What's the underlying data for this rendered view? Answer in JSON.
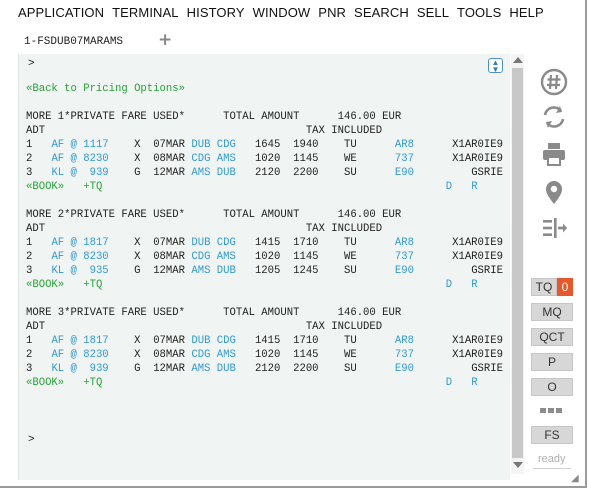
{
  "menu": [
    "APPLICATION",
    "TERMINAL",
    "HISTORY",
    "WINDOW",
    "PNR",
    "SEARCH",
    "SELL",
    "TOOLS",
    "HELP"
  ],
  "tab": {
    "label": "1-FSDUB07MARAMS",
    "add_symbol": "+"
  },
  "terminal": {
    "prompt": ">",
    "back_link": "«Back to Pricing Options»",
    "blocks": [
      {
        "header_left": "MORE 1*PRIVATE FARE USED*",
        "total_label": "TOTAL AMOUNT",
        "total_value": "146.00 EUR",
        "pax": "ADT",
        "tax_label": "TAX INCLUDED",
        "segments": [
          {
            "n": "1",
            "airline": "AF",
            "at": "@",
            "flight": "1117",
            "cls": "X",
            "date": "07MAR",
            "from": "DUB",
            "to": "CDG",
            "dep": "1645",
            "arr": "1940",
            "day": "TU",
            "equip": "AR8",
            "fare": "X1AR0IE9"
          },
          {
            "n": "2",
            "airline": "AF",
            "at": "@",
            "flight": "8230",
            "cls": "X",
            "date": "08MAR",
            "from": "CDG",
            "to": "AMS",
            "dep": "1020",
            "arr": "1145",
            "day": "WE",
            "equip": "737",
            "fare": "X1AR0IE9"
          },
          {
            "n": "3",
            "airline": "KL",
            "at": "@",
            "flight": "939",
            "cls": "G",
            "date": "12MAR",
            "from": "AMS",
            "to": "DUB",
            "dep": "2120",
            "arr": "2200",
            "day": "SU",
            "equip": "E90",
            "fare": "GSRIE"
          }
        ],
        "book": "«BOOK»",
        "tq": "+TQ",
        "d": "D",
        "r": "R"
      },
      {
        "header_left": "MORE 2*PRIVATE FARE USED*",
        "total_label": "TOTAL AMOUNT",
        "total_value": "146.00 EUR",
        "pax": "ADT",
        "tax_label": "TAX INCLUDED",
        "segments": [
          {
            "n": "1",
            "airline": "AF",
            "at": "@",
            "flight": "1817",
            "cls": "X",
            "date": "07MAR",
            "from": "DUB",
            "to": "CDG",
            "dep": "1415",
            "arr": "1710",
            "day": "TU",
            "equip": "AR8",
            "fare": "X1AR0IE9"
          },
          {
            "n": "2",
            "airline": "AF",
            "at": "@",
            "flight": "8230",
            "cls": "X",
            "date": "08MAR",
            "from": "CDG",
            "to": "AMS",
            "dep": "1020",
            "arr": "1145",
            "day": "WE",
            "equip": "737",
            "fare": "X1AR0IE9"
          },
          {
            "n": "3",
            "airline": "KL",
            "at": "@",
            "flight": "935",
            "cls": "G",
            "date": "12MAR",
            "from": "AMS",
            "to": "DUB",
            "dep": "1205",
            "arr": "1245",
            "day": "SU",
            "equip": "E90",
            "fare": "GSRIE"
          }
        ],
        "book": "«BOOK»",
        "tq": "+TQ",
        "d": "D",
        "r": "R"
      },
      {
        "header_left": "MORE 3*PRIVATE FARE USED*",
        "total_label": "TOTAL AMOUNT",
        "total_value": "146.00 EUR",
        "pax": "ADT",
        "tax_label": "TAX INCLUDED",
        "segments": [
          {
            "n": "1",
            "airline": "AF",
            "at": "@",
            "flight": "1817",
            "cls": "X",
            "date": "07MAR",
            "from": "DUB",
            "to": "CDG",
            "dep": "1415",
            "arr": "1710",
            "day": "TU",
            "equip": "AR8",
            "fare": "X1AR0IE9"
          },
          {
            "n": "2",
            "airline": "AF",
            "at": "@",
            "flight": "8230",
            "cls": "X",
            "date": "08MAR",
            "from": "CDG",
            "to": "AMS",
            "dep": "1020",
            "arr": "1145",
            "day": "WE",
            "equip": "737",
            "fare": "X1AR0IE9"
          },
          {
            "n": "3",
            "airline": "KL",
            "at": "@",
            "flight": "939",
            "cls": "G",
            "date": "12MAR",
            "from": "AMS",
            "to": "DUB",
            "dep": "2120",
            "arr": "2200",
            "day": "SU",
            "equip": "E90",
            "fare": "GSRIE"
          }
        ],
        "book": "«BOOK»",
        "tq": "+TQ",
        "d": "D",
        "r": "R"
      }
    ]
  },
  "toolbar": {
    "icons": [
      "hash-icon",
      "refresh-icon",
      "print-icon",
      "location-pin-icon",
      "align-arrow-icon"
    ],
    "tq_label": "TQ",
    "tq_count": "0",
    "buttons": [
      "MQ",
      "QCT",
      "P",
      "O"
    ],
    "fs_label": "FS",
    "status": "ready"
  },
  "colors": {
    "link_blue": "#2f9ad9",
    "link_green": "#27a337",
    "tq_badge": "#e8572a",
    "panel_bg": "#f0f4f2"
  }
}
